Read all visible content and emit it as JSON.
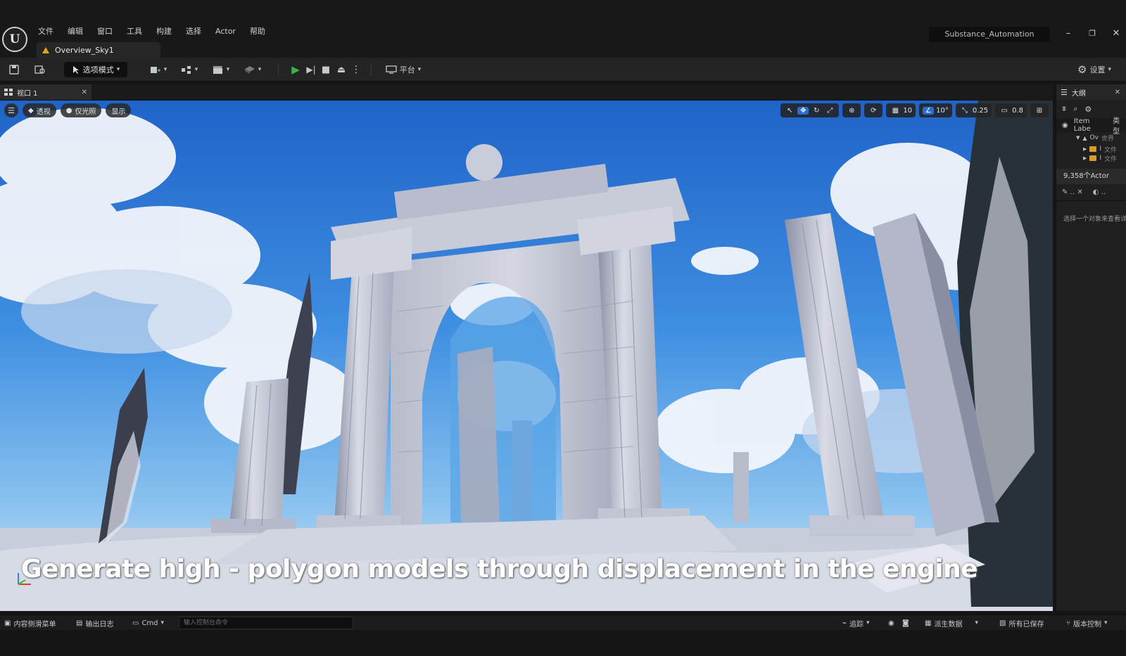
{
  "app": {
    "menu": [
      "文件",
      "编辑",
      "窗口",
      "工具",
      "构建",
      "选择",
      "Actor",
      "帮助"
    ],
    "project_name": "Substance_Automation",
    "level_tab": "Overview_Sky1"
  },
  "toolbar": {
    "mode_label": "选项模式",
    "platform_label": "平台",
    "settings_label": "设置"
  },
  "viewport": {
    "tab_label": "视口 1",
    "perspective_label": "透视",
    "lighting_label": "仅光照",
    "show_label": "显示",
    "grid_snap": "10",
    "rotation_snap": "10°",
    "scale_snap": "0.25",
    "camera_speed": "0.8",
    "caption": "Generate high - polygon models through displacement in the engine"
  },
  "outliner": {
    "title": "大纲",
    "col_label": "Item Labe",
    "col_type": "类型",
    "tree": [
      {
        "label": "Ov",
        "type": "世界"
      },
      {
        "label": "I",
        "type": "文件"
      },
      {
        "label": "I",
        "type": "文件"
      }
    ],
    "actor_count": "9,358个Actor",
    "details_hint": "选择一个对象来查看详"
  },
  "statusbar": {
    "content_drawer": "内容侧滑菜单",
    "output_log": "输出日志",
    "cmd_label": "Cmd",
    "console_placeholder": "输入控制台命令",
    "trace_label": "追踪",
    "derived_data": "派生数据",
    "all_saved": "所有已保存",
    "version_control": "版本控制"
  },
  "colors": {
    "accent": "#2a6fd0",
    "play": "#3fb04a",
    "level_icon": "#e2a220"
  }
}
